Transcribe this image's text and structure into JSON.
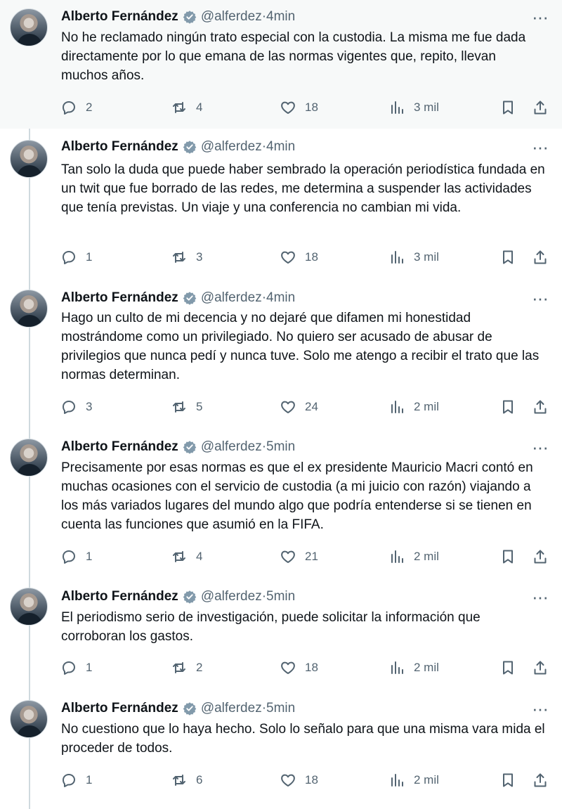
{
  "tweets": [
    {
      "name": "Alberto Fernández",
      "handle": "@alferdez",
      "time": "4min",
      "text": "No he reclamado ningún trato especial con la custodia. La misma me fue dada directamente por lo que emana de las normas vigentes que, repito, llevan muchos años.",
      "replies": "2",
      "retweets": "4",
      "likes": "18",
      "views": "3 mil"
    },
    {
      "name": "Alberto Fernández",
      "handle": "@alferdez",
      "time": "4min",
      "text": "Tan solo la duda que puede haber sembrado la operación  periodística fundada en un twit que fue borrado de las redes, me determina a suspender las actividades que tenía previstas. Un viaje y una conferencia no cambian mi vida.",
      "replies": "1",
      "retweets": "3",
      "likes": "18",
      "views": "3 mil"
    },
    {
      "name": "Alberto Fernández",
      "handle": "@alferdez",
      "time": "4min",
      "text": "Hago un culto de mi decencia y no dejaré que difamen mi honestidad mostrándome como un privilegiado. No quiero ser acusado de abusar de privilegios que nunca pedí y nunca tuve. Solo me atengo a recibir el trato que las normas determinan.",
      "replies": "3",
      "retweets": "5",
      "likes": "24",
      "views": "2 mil"
    },
    {
      "name": "Alberto Fernández",
      "handle": "@alferdez",
      "time": "5min",
      "text": "Precisamente por esas normas es que el ex presidente Mauricio Macri contó en muchas ocasiones con el servicio de custodia (a mi juicio con razón) viajando a los más variados lugares del mundo algo que podría entenderse si se tienen en cuenta las funciones que asumió en la FIFA.",
      "replies": "1",
      "retweets": "4",
      "likes": "21",
      "views": "2 mil"
    },
    {
      "name": "Alberto Fernández",
      "handle": "@alferdez",
      "time": "5min",
      "text": "El periodismo serio de investigación, puede solicitar la información que corroboran los gastos.",
      "replies": "1",
      "retweets": "2",
      "likes": "18",
      "views": "2 mil"
    },
    {
      "name": "Alberto Fernández",
      "handle": "@alferdez",
      "time": "5min",
      "text": "No cuestiono que lo haya hecho. Solo lo señalo para que una misma vara mida el proceder de todos.",
      "replies": "1",
      "retweets": "6",
      "likes": "18",
      "views": "2 mil"
    }
  ],
  "separator": " · ",
  "more_label": "···",
  "colors": {
    "accent": "#1d9bf0",
    "muted": "#536471",
    "text": "#0f1419",
    "highlight": "#f7f9f9",
    "verified": "#829aab"
  }
}
